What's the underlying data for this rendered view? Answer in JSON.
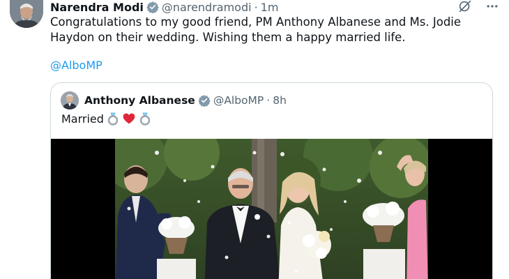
{
  "tweet": {
    "author_name": "Narendra Modi",
    "handle": "@narendramodi",
    "separator": "·",
    "time": "1m",
    "text": "Congratulations to my good friend, PM Anthony Albanese and Ms. Jodie Haydon on their wedding. Wishing them a happy married life.",
    "mention": "@AlboMP"
  },
  "quoted_tweet": {
    "author_name": "Anthony Albanese",
    "handle": "@AlboMP",
    "separator": "·",
    "time": "8h",
    "text": "Married",
    "emojis": [
      "ring-icon",
      "red-heart-icon",
      "ring-icon"
    ]
  },
  "icons": {
    "verified_badge": "verified-badge-icon",
    "grok": "grok-icon",
    "more": "more-icon"
  },
  "colors": {
    "link": "#1d9bf0",
    "verified_gray": "#829aab",
    "secondary_text": "#536471",
    "border": "#cfd9de"
  }
}
